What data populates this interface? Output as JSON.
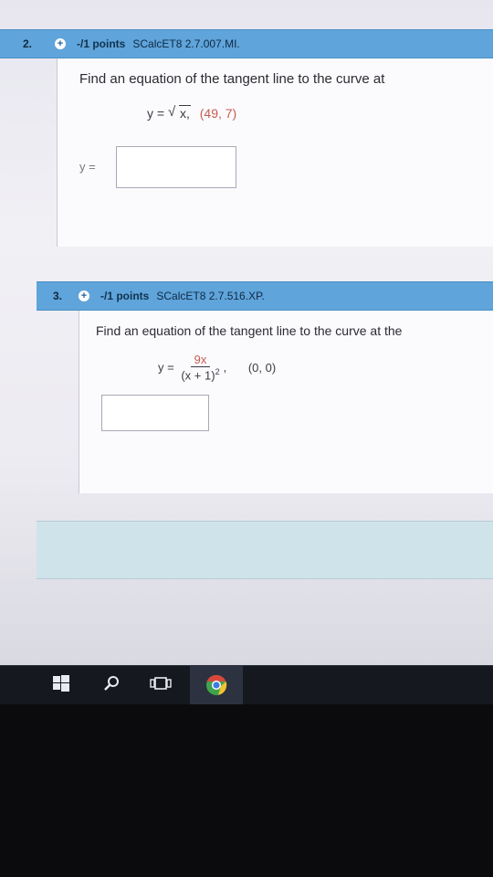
{
  "questions": [
    {
      "number": "2.",
      "points": "-/1 points",
      "source": "SCalcET8 2.7.007.MI.",
      "prompt": "Find an equation of the tangent line to the curve at",
      "equation": {
        "lhs": "y =",
        "radicand": "x,",
        "point": "(49, 7)"
      },
      "answer_label": "y ="
    },
    {
      "number": "3.",
      "points": "-/1 points",
      "source": "SCalcET8 2.7.516.XP.",
      "prompt": "Find an equation of the tangent line to the curve at the",
      "equation": {
        "lhs": "y =",
        "numerator": "9x",
        "denominator": "(x + 1)",
        "exponent": "2",
        "comma": ",",
        "point": "(0, 0)"
      }
    }
  ],
  "icons": [
    "plus-circle-icon",
    "windows-start-icon",
    "search-icon",
    "task-view-icon",
    "chrome-icon"
  ],
  "colors": {
    "header": "#5fa4da",
    "point_red": "#c95a50",
    "panel": "#cfe3ea",
    "taskbar": "#15181f"
  }
}
